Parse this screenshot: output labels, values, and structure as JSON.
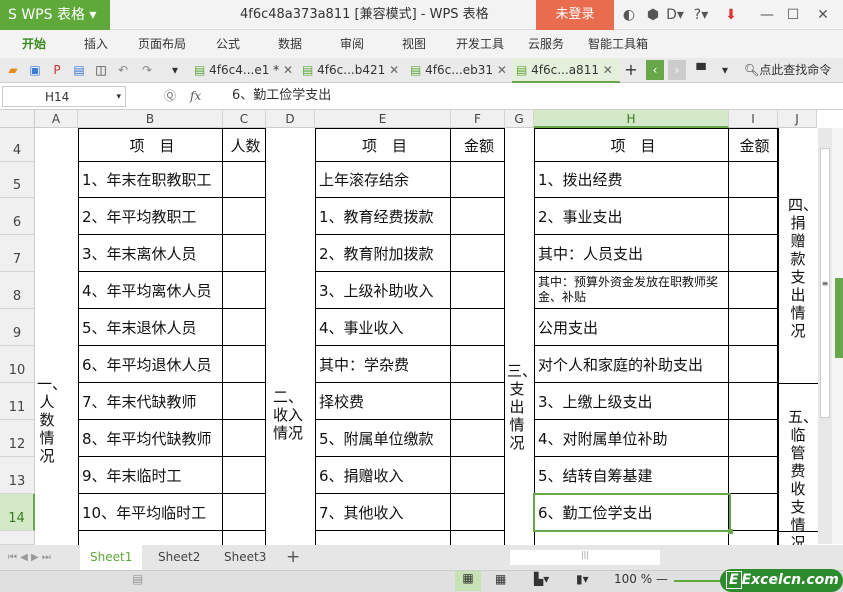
{
  "app": {
    "logo": "S WPS 表格",
    "title": "4f6c48a373a811 [兼容模式] - WPS 表格",
    "login": "未登录"
  },
  "menu": [
    "开始",
    "插入",
    "页面布局",
    "公式",
    "数据",
    "审阅",
    "视图",
    "开发工具",
    "云服务",
    "智能工具箱"
  ],
  "doc_tabs": [
    {
      "label": "4f6c4...e1 *"
    },
    {
      "label": "4f6c...b421"
    },
    {
      "label": "4f6c...eb31"
    },
    {
      "label": "4f6c...a811",
      "active": true
    }
  ],
  "search_cmd": "点此查找命令",
  "formula_bar": {
    "name_box": "H14",
    "fx": "fx",
    "value": "6、勤工俭学支出"
  },
  "columns": [
    "A",
    "B",
    "C",
    "D",
    "E",
    "F",
    "G",
    "H",
    "I",
    "J"
  ],
  "selected_column": "H",
  "rows": [
    "4",
    "5",
    "6",
    "7",
    "8",
    "9",
    "10",
    "11",
    "12",
    "13",
    "14"
  ],
  "selected_row": "14",
  "headers": {
    "b": "项　目",
    "c": "人数",
    "e": "项　目",
    "f": "金额",
    "h": "项　目",
    "i": "金额"
  },
  "col_b": [
    "1、年末在职教职工",
    "2、年平均教职工",
    "3、年末离休人员",
    "4、年平均离休人员",
    "5、年末退休人员",
    "6、年平均退休人员",
    "7、年末代缺教师",
    "8、年平均代缺教师",
    "9、年末临时工",
    "10、年平均临时工"
  ],
  "col_e": [
    "上年滚存结余",
    "1、教育经费拨款",
    "2、教育附加拨款",
    "3、上级补助收入",
    "4、事业收入",
    "其中：学杂费",
    "择校费",
    "5、附属单位缴款",
    "6、捐赠收入",
    "7、其他收入"
  ],
  "col_h": [
    "1、拨出经费",
    "2、事业支出",
    "其中：人员支出",
    "其中：预算外资金发放在职教师奖金、补贴",
    "公用支出",
    "对个人和家庭的补助支出",
    "3、上缴上级支出",
    "4、对附属单位补助",
    "5、结转自筹基建",
    "6、勤工俭学支出"
  ],
  "merged": {
    "a": "一、人数情况",
    "d": "二、收入情况",
    "g": "三、支出情况",
    "j1": "四、捐赠款支出情况",
    "j2": "五、临管费收支情况"
  },
  "sheets": [
    "Sheet1",
    "Sheet2",
    "Sheet3"
  ],
  "active_sheet": "Sheet1",
  "zoom": "100 %",
  "watermark": "Excelcn.com",
  "colors": {
    "accent": "#5fa83a",
    "login": "#e96c4f"
  }
}
